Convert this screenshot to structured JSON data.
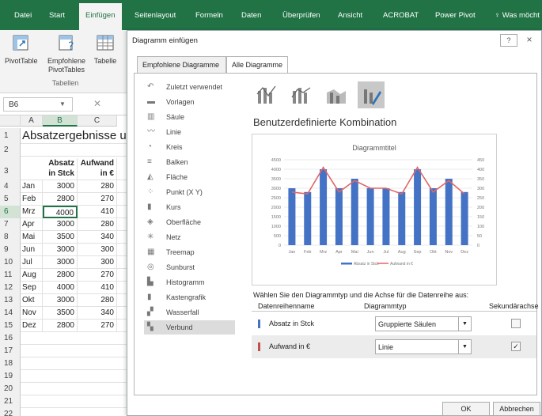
{
  "ribbon": {
    "tabs": [
      "Datei",
      "Start",
      "Einfügen",
      "Seitenlayout",
      "Formeln",
      "Daten",
      "Überprüfen",
      "Ansicht",
      "ACROBAT",
      "Power Pivot",
      "Was möcht"
    ],
    "active_tab": "Einfügen",
    "buttons": [
      "PivotTable",
      "Empfohlene PivotTables",
      "Tabelle"
    ],
    "group_label": "Tabellen"
  },
  "namebox": "B6",
  "sheet": {
    "columns": [
      "A",
      "B",
      "C"
    ],
    "title": "Absatzergebnisse u",
    "headers": {
      "b1": "Absatz",
      "b2": "in Stck",
      "c1": "Aufwand",
      "c2": "in €"
    },
    "data": [
      [
        "Jan",
        "3000",
        "280"
      ],
      [
        "Feb",
        "2800",
        "270"
      ],
      [
        "Mrz",
        "4000",
        "410"
      ],
      [
        "Apr",
        "3000",
        "280"
      ],
      [
        "Mai",
        "3500",
        "340"
      ],
      [
        "Jun",
        "3000",
        "300"
      ],
      [
        "Jul",
        "3000",
        "300"
      ],
      [
        "Aug",
        "2800",
        "270"
      ],
      [
        "Sep",
        "4000",
        "410"
      ],
      [
        "Okt",
        "3000",
        "280"
      ],
      [
        "Nov",
        "3500",
        "340"
      ],
      [
        "Dez",
        "2800",
        "270"
      ]
    ],
    "row_numbers": [
      "1",
      "2",
      "3",
      "4",
      "5",
      "6",
      "7",
      "8",
      "9",
      "10",
      "11",
      "12",
      "13",
      "14",
      "15",
      "16",
      "17",
      "18",
      "19",
      "20",
      "21",
      "22"
    ]
  },
  "dialog": {
    "title": "Diagramm einfügen",
    "help": "?",
    "close": "×",
    "tabs": [
      "Empfohlene Diagramme",
      "Alle Diagramme"
    ],
    "active_tab": "Alle Diagramme",
    "chart_types": [
      "Zuletzt verwendet",
      "Vorlagen",
      "Säule",
      "Linie",
      "Kreis",
      "Balken",
      "Fläche",
      "Punkt (X Y)",
      "Kurs",
      "Oberfläche",
      "Netz",
      "Treemap",
      "Sunburst",
      "Histogramm",
      "Kastengrafik",
      "Wasserfall",
      "Verbund"
    ],
    "selected_type": "Verbund",
    "combo_title": "Benutzerdefinierte Kombination",
    "series_hint": "Wählen Sie den Diagrammtyp und die Achse für die Datenreihe aus:",
    "series_headers": [
      "Datenreihenname",
      "Diagrammtyp",
      "Sekundärachse"
    ],
    "series": [
      {
        "name": "Absatz in Stck",
        "type": "Gruppierte Säulen",
        "secondary": false,
        "color": "#4472c4"
      },
      {
        "name": "Aufwand in €",
        "type": "Linie",
        "secondary": true,
        "color": "#c0504d"
      }
    ],
    "ok": "OK",
    "cancel": "Abbrechen"
  },
  "chart_data": {
    "type": "bar",
    "title": "Diagrammtitel",
    "categories": [
      "Jan",
      "Feb",
      "Mrz",
      "Apr",
      "Mai",
      "Jun",
      "Jul",
      "Aug",
      "Sep",
      "Okt",
      "Nov",
      "Dez"
    ],
    "series": [
      {
        "name": "Absatz in Stck",
        "kind": "bar",
        "axis": "primary",
        "color": "#4472c4",
        "values": [
          3000,
          2800,
          4000,
          3000,
          3500,
          3000,
          3000,
          2800,
          4000,
          3000,
          3500,
          2800
        ]
      },
      {
        "name": "Aufwand in €",
        "kind": "line",
        "axis": "secondary",
        "color": "#e06666",
        "values": [
          280,
          270,
          410,
          280,
          340,
          300,
          300,
          270,
          410,
          280,
          340,
          270
        ]
      }
    ],
    "y_primary": {
      "min": 0,
      "max": 4500,
      "ticks": [
        "4500",
        "4000",
        "3500",
        "3000",
        "2500",
        "2000",
        "1500",
        "1000",
        "500",
        "0"
      ]
    },
    "y_secondary": {
      "min": 0,
      "max": 450,
      "ticks": [
        "450",
        "400",
        "350",
        "300",
        "250",
        "200",
        "150",
        "100",
        "50",
        "0"
      ]
    },
    "legend": "bottom"
  }
}
